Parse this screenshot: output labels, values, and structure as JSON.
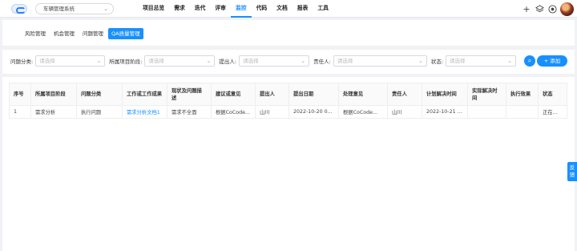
{
  "header": {
    "project": "车辆管理系统",
    "nav": [
      "项目总览",
      "需求",
      "迭代",
      "评审",
      "监控",
      "代码",
      "文档",
      "报表",
      "工具"
    ],
    "active_nav": "监控",
    "icons": [
      "plus-icon",
      "layers-icon",
      "target-icon",
      "avatar"
    ]
  },
  "subtabs": {
    "items": [
      "风险管理",
      "机会管理",
      "问题管理",
      "QA质量管理"
    ],
    "active": "QA质量管理"
  },
  "filters": {
    "issue_type": {
      "label": "问题分类:",
      "placeholder": "请选择"
    },
    "stage": {
      "label": "所属项目阶段:",
      "placeholder": "请选择"
    },
    "proposer": {
      "label": "提出人:",
      "placeholder": "请选择"
    },
    "owner": {
      "label": "责任人:",
      "placeholder": "请选择"
    },
    "status": {
      "label": "状态:",
      "placeholder": "请选择"
    },
    "add_label": "+ 添加"
  },
  "table": {
    "columns": [
      "序号",
      "所属项目阶段",
      "问题分类",
      "工作或工作成果",
      "现状及问题描述",
      "建议或意见",
      "提出人",
      "提出日期",
      "处理意见",
      "责任人",
      "计划解决时间",
      "实际解决时间",
      "执行效果",
      "状态"
    ],
    "rows": [
      [
        "1",
        "需求分析",
        "执行问题",
        "需求分析文档1",
        "需求不全面",
        "根据CoCode...",
        "山川",
        "2022-10-20 0...",
        "根据CoCode...",
        "山川",
        "2022-10-21 0...",
        "",
        "",
        "正在..."
      ]
    ]
  },
  "feedback": "反馈"
}
